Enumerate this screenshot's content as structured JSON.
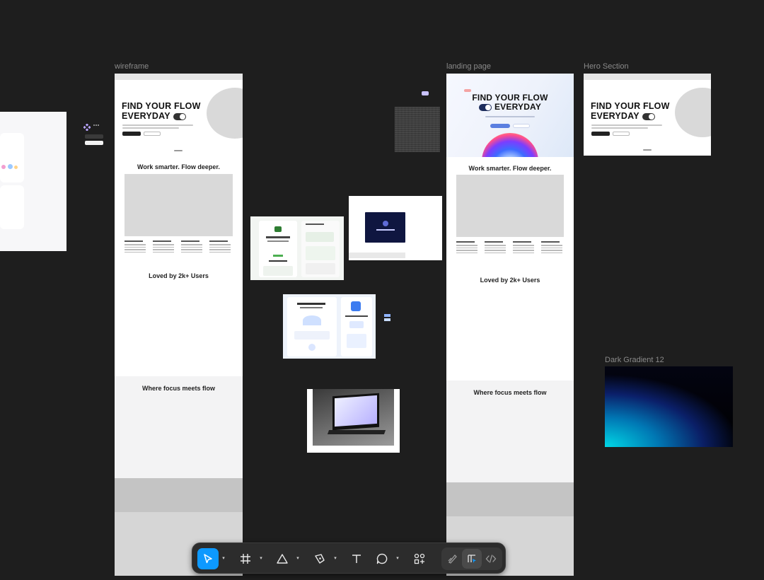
{
  "canvas": {
    "background": "#1e1e1e",
    "frames": {
      "wireframe": {
        "label": "wireframe",
        "hero_line1": "FIND YOUR FLOW",
        "hero_line2": "EVERYDAY",
        "section1_title": "Work smarter. Flow deeper.",
        "section2_title": "Loved by 2k+ Users",
        "section3_title": "Where focus meets flow"
      },
      "landing_page": {
        "label": "landing page",
        "hero_line1": "FIND YOUR FLOW",
        "hero_line2": "EVERYDAY",
        "section1_title": "Work smarter. Flow deeper.",
        "section2_title": "Loved by 2k+ Users",
        "section3_title": "Where focus meets flow"
      },
      "hero_section": {
        "label": "Hero Section",
        "hero_line1": "FIND YOUR FLOW",
        "hero_line2": "EVERYDAY"
      },
      "dark_gradient": {
        "label": "Dark Gradient 12"
      }
    }
  },
  "toolbar": {
    "tools": [
      {
        "name": "move-tool",
        "icon": "cursor-icon",
        "active": true
      },
      {
        "name": "frame-tool",
        "icon": "hash-frame-icon",
        "active": false
      },
      {
        "name": "shape-tool",
        "icon": "triangle-icon",
        "active": false
      },
      {
        "name": "pen-tool",
        "icon": "pen-icon",
        "active": false
      },
      {
        "name": "text-tool",
        "icon": "text-icon",
        "active": false
      },
      {
        "name": "comment-tool",
        "icon": "comment-icon",
        "active": false
      },
      {
        "name": "resources-tool",
        "icon": "resources-icon",
        "active": false
      }
    ],
    "modes": [
      {
        "name": "draw-mode",
        "icon": "draw-mode-icon",
        "active": false
      },
      {
        "name": "design-mode",
        "icon": "design-mode-icon",
        "active": true
      },
      {
        "name": "dev-mode",
        "icon": "code-icon",
        "active": false
      }
    ],
    "accent_color": "#0d99ff"
  }
}
